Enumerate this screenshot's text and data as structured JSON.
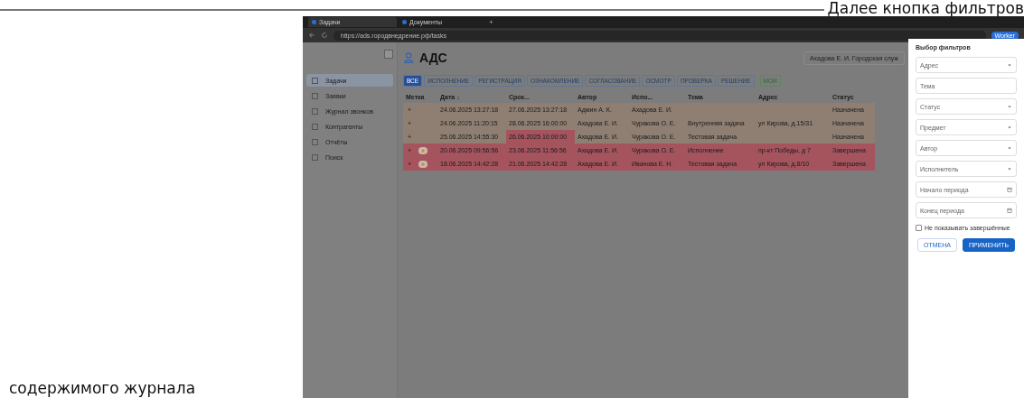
{
  "document": {
    "text_top": "Далее кнопка фильтров",
    "text_bottom": "содержимого журнала"
  },
  "browser": {
    "tabs": [
      {
        "label": "Задачи",
        "selected": true
      },
      {
        "label": "Документы",
        "selected": false
      }
    ],
    "new_tab": "+",
    "url": "https://ads.городвнедрение.рф/tasks",
    "profile": "Worker"
  },
  "app": {
    "title": "АДС",
    "user": "Ахадова Е. И. Городская служ",
    "sidebar": {
      "items": [
        {
          "label": "Задачи",
          "selected": true
        },
        {
          "label": "Заявки",
          "selected": false
        },
        {
          "label": "Журнал звонков",
          "selected": false
        },
        {
          "label": "Контрагенты",
          "selected": false
        },
        {
          "label": "Отчёты",
          "selected": false
        },
        {
          "label": "Поиск",
          "selected": false
        }
      ]
    },
    "filter_tabs": [
      {
        "label": "ВСЕ",
        "selected": true,
        "kind": "stage"
      },
      {
        "label": "ИСПОЛНЕНИЕ",
        "selected": false,
        "kind": "stage"
      },
      {
        "label": "РЕГИСТРАЦИЯ",
        "selected": false,
        "kind": "stage"
      },
      {
        "label": "ОЗНАКОМЛЕНИЕ",
        "selected": false,
        "kind": "stage"
      },
      {
        "label": "СОГЛАСОВАНИЕ",
        "selected": false,
        "kind": "stage"
      },
      {
        "label": "ОСМОТР",
        "selected": false,
        "kind": "stage"
      },
      {
        "label": "ПРОВЕРКА",
        "selected": false,
        "kind": "stage"
      },
      {
        "label": "РЕШЕНИЕ",
        "selected": false,
        "kind": "stage"
      },
      {
        "label": "МОИ",
        "selected": false,
        "kind": "mine"
      }
    ],
    "table": {
      "columns": [
        "Метка",
        "Дата ↓",
        "Срок...",
        "Автор",
        "Испо...",
        "Тема",
        "Адрес",
        "Статус"
      ],
      "rows": [
        {
          "kind": "open",
          "starred": false,
          "overdue": false,
          "cells": [
            "+",
            "24.06.2025 13:27:18",
            "27.06.2025 13:27:18",
            "Админ А. К.",
            "Ахадова Е. И.",
            "",
            "",
            "Назначена"
          ]
        },
        {
          "kind": "open",
          "starred": false,
          "overdue": false,
          "cells": [
            "+",
            "24.06.2025 11:20:15",
            "28.06.2025 16:00:00",
            "Ахадова Е. И.",
            "Чуракова О. Е.",
            "Внутренняя задача",
            "ул Кирова, д.15/31",
            "Назначена"
          ]
        },
        {
          "kind": "open",
          "starred": false,
          "overdue": true,
          "cells": [
            "+",
            "25.06.2025 14:55:30",
            "26.06.2025 10:00:00",
            "Ахадова Е. И.",
            "Чуракова О. Е.",
            "Тестовая задача",
            "",
            "Назначена"
          ]
        },
        {
          "kind": "done",
          "starred": true,
          "overdue": false,
          "cells": [
            "+",
            "20.06.2025 09:56:56",
            "23.06.2025 11:56:56",
            "Ахадова Е. И.",
            "Чуракова О. Е.",
            "Исполнение",
            "пр-кт Победы, д 7",
            "Завершена"
          ]
        },
        {
          "kind": "done",
          "starred": true,
          "overdue": false,
          "cells": [
            "+",
            "18.06.2025 14:42:28",
            "21.06.2025 14:42:28",
            "Ахадова Е. И.",
            "Иванова Е. Н.",
            "Тестовая задача",
            "ул Кирова, д.8/10",
            "Завершена"
          ]
        }
      ]
    }
  },
  "filter_panel": {
    "title": "Выбор фильтров",
    "fields": [
      {
        "kind": "select",
        "placeholder": "Адрес"
      },
      {
        "kind": "text",
        "placeholder": "Тема"
      },
      {
        "kind": "select",
        "placeholder": "Статус"
      },
      {
        "kind": "select",
        "placeholder": "Предмет"
      },
      {
        "kind": "select",
        "placeholder": "Автор"
      },
      {
        "kind": "select",
        "placeholder": "Исполнитель"
      },
      {
        "kind": "date",
        "placeholder": "Начало периода"
      },
      {
        "kind": "date",
        "placeholder": "Конец периода"
      }
    ],
    "hide_completed": {
      "label": "Не показывать завершённые",
      "checked": false
    },
    "cancel": "ОТМЕНА",
    "apply": "ПРИМЕНИТЬ"
  }
}
